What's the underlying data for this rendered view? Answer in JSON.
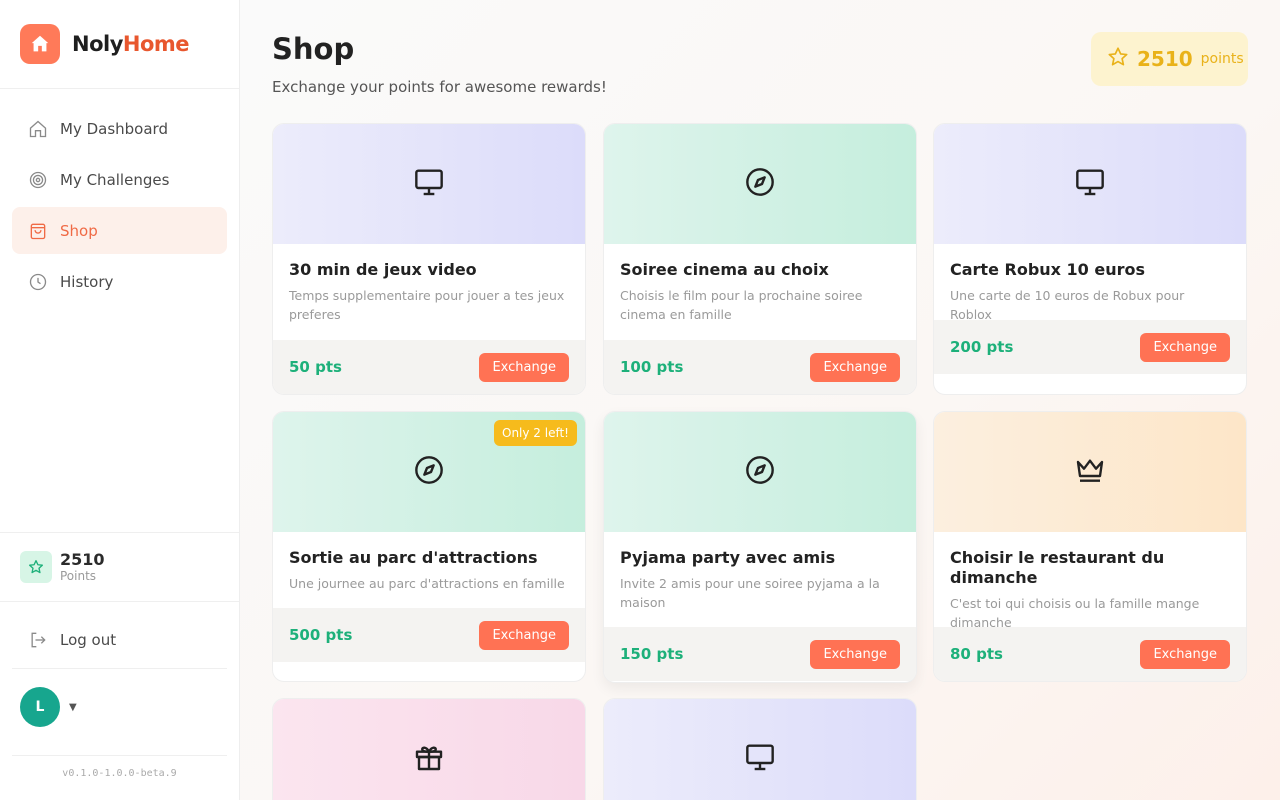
{
  "brand": {
    "name_part1": "Noly",
    "name_part2": "Home"
  },
  "nav": [
    {
      "label": "My Dashboard",
      "icon": "home-icon"
    },
    {
      "label": "My Challenges",
      "icon": "target-icon"
    },
    {
      "label": "Shop",
      "icon": "shopping-bag-icon",
      "active": true
    },
    {
      "label": "History",
      "icon": "clock-icon"
    }
  ],
  "sidebar_points": {
    "value": "2510",
    "label": "Points"
  },
  "logout_label": "Log out",
  "user": {
    "initial": "L"
  },
  "version": "v0.1.0-1.0.0-beta.9",
  "page": {
    "title": "Shop",
    "subtitle": "Exchange your points for awesome rewards!"
  },
  "points_pill": {
    "value": "2510",
    "label": "points"
  },
  "exchange_label": "Exchange",
  "items": [
    {
      "title": "30 min de jeux video",
      "desc": "Temps supplementaire pour jouer a tes jeux preferes",
      "price": "50 pts",
      "icon": "monitor-icon"
    },
    {
      "title": "Soiree cinema au choix",
      "desc": "Choisis le film pour la prochaine soiree cinema en famille",
      "price": "100 pts",
      "icon": "compass-icon"
    },
    {
      "title": "Carte Robux 10 euros",
      "desc": "Une carte de 10 euros de Robux pour Roblox",
      "price": "200 pts",
      "icon": "monitor-icon"
    },
    {
      "title": "Sortie au parc d'attractions",
      "desc": "Une journee au parc d'attractions en famille",
      "price": "500 pts",
      "icon": "compass-icon",
      "badge": "Only 2 left!"
    },
    {
      "title": "Pyjama party avec amis",
      "desc": "Invite 2 amis pour une soiree pyjama a la maison",
      "price": "150 pts",
      "icon": "compass-icon"
    },
    {
      "title": "Choisir le restaurant du dimanche",
      "desc": "C'est toi qui choisis ou la famille mange dimanche",
      "price": "80 pts",
      "icon": "crown-icon"
    },
    {
      "icon": "gift-icon"
    },
    {
      "icon": "monitor-icon"
    }
  ],
  "colors": {
    "accent": "#ff7254",
    "brand": "#e8572e",
    "price": "#1db07a",
    "points": "#e9b21a"
  }
}
